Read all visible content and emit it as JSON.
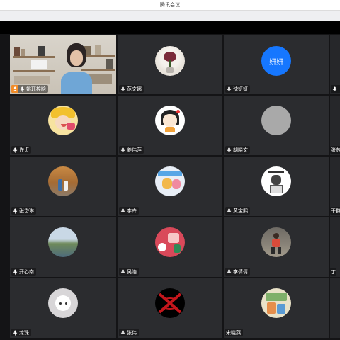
{
  "window": {
    "title": "腾讯会议"
  },
  "colors": {
    "tile": "#2b2c2f",
    "gap": "#141416",
    "text_avatar": "#1677ff",
    "host_badge": "#f28c28"
  },
  "participants": {
    "p1": {
      "name": "姚珏梓晗",
      "host": true,
      "video": true
    },
    "p2": {
      "name": "范文娜",
      "avatar_icon": "flower-vase-photo-icon"
    },
    "p3": {
      "name": "沈妍妍",
      "avatar_text": "妍妍"
    },
    "p4": {
      "name": "许贞",
      "avatar_icon": "cartoon-boy-icon"
    },
    "p5": {
      "name": "姜伟萍",
      "avatar_icon": "cartoon-girl-icon"
    },
    "p6": {
      "name": "胡晓文",
      "avatar_icon": "blank-gray-avatar-icon"
    },
    "p7": {
      "name": "张岱琳",
      "avatar_icon": "autumn-street-photo-icon"
    },
    "p8": {
      "name": "李卉",
      "avatar_icon": "cartoon-card-icon"
    },
    "p9": {
      "name": "黄宝熙",
      "avatar_icon": "cartoon-character-icon"
    },
    "p10": {
      "name": "开心南",
      "avatar_icon": "coastline-photo-icon"
    },
    "p11": {
      "name": "吴浩",
      "avatar_icon": "toy-collage-icon"
    },
    "p12": {
      "name": "李倩倩",
      "avatar_icon": "child-running-photo-icon"
    },
    "p13": {
      "name": "龙珠",
      "avatar_icon": "white-cat-photo-icon"
    },
    "p14": {
      "name": "张伟",
      "avatar_icon": "chu-era-logo-icon"
    },
    "p15": {
      "name": "宋晓燕",
      "avatar_icon": "poster-drawing-icon"
    },
    "edge_names": [
      "张苏",
      "干群",
      "丁"
    ]
  }
}
